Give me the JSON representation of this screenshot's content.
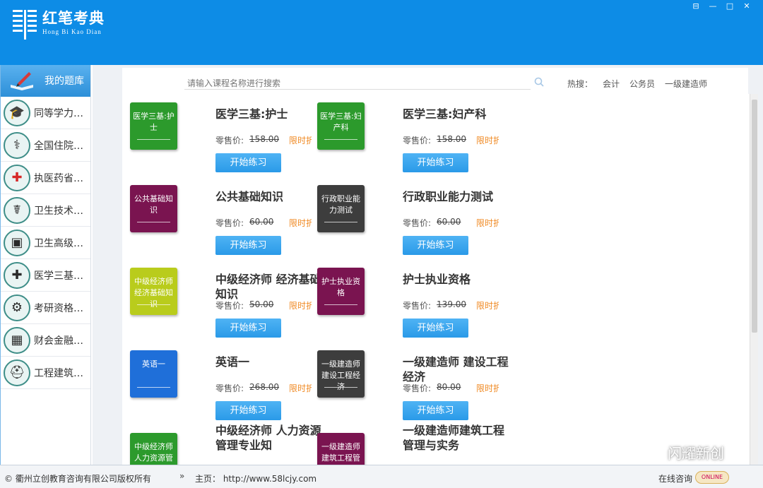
{
  "app": {
    "logo_cn": "红笔考典",
    "logo_en": "Hong Bi Kao Dian"
  },
  "window_buttons": [
    "⊟",
    "—",
    "□",
    "✕"
  ],
  "sidebar": {
    "header": "我的题库",
    "items": [
      {
        "label": "同等学力…",
        "icon": "graduation-cap-icon"
      },
      {
        "label": "全国住院…",
        "icon": "doctor-icon"
      },
      {
        "label": "执医药省…",
        "icon": "red-cross-icon"
      },
      {
        "label": "卫生技术…",
        "icon": "nurse-icon"
      },
      {
        "label": "卫生高级…",
        "icon": "medical-kit-icon"
      },
      {
        "label": "医学三基…",
        "icon": "first-aid-icon"
      },
      {
        "label": "考研资格…",
        "icon": "gear-cluster-icon"
      },
      {
        "label": "财会金融…",
        "icon": "calculator-icon"
      },
      {
        "label": "工程建筑…",
        "icon": "hard-hat-icon"
      }
    ]
  },
  "search": {
    "placeholder": "请输入课程名称进行搜索"
  },
  "hot": {
    "label": "热搜：",
    "terms": [
      "会计",
      "公务员",
      "一级建造师"
    ]
  },
  "price_label": "零售价:",
  "limit_label": "限时折",
  "start_label": "开始练习",
  "courses": [
    {
      "cover": "医学三基:护士",
      "title": "医学三基:护士",
      "price": "158.00",
      "color": "#2c9a2c"
    },
    {
      "cover": "医学三基:妇产科",
      "title": "医学三基:妇产科",
      "price": "158.00",
      "color": "#2c9a2c"
    },
    {
      "cover": "公共基础知识",
      "title": "公共基础知识",
      "price": "60.00",
      "color": "#7a1450"
    },
    {
      "cover": "行政职业能力测试",
      "title": "行政职业能力测试",
      "price": "60.00",
      "color": "#3d3d3d"
    },
    {
      "cover": "中级经济师经济基础知识",
      "title": "中级经济师 经济基础知识",
      "price": "50.00",
      "color": "#b9cc1c"
    },
    {
      "cover": "护士执业资格",
      "title": "护士执业资格",
      "price": "139.00",
      "color": "#7a1450"
    },
    {
      "cover": "英语一",
      "title": "英语一",
      "price": "268.00",
      "color": "#1f6fd9"
    },
    {
      "cover": "一级建造师建设工程经济",
      "title": "一级建造师 建设工程经济",
      "price": "80.00",
      "color": "#3d3d3d"
    },
    {
      "cover": "中级经济师 人力资源管理专业知识与实务",
      "title": "中级经济师 人力资源管理专业知",
      "price": "",
      "color": "#2c9a2c"
    },
    {
      "cover": "一级建造师建筑工程管理与实务",
      "title": "一级建造师建筑工程管理与实务",
      "price": "",
      "color": "#7a1450"
    }
  ],
  "statusbar": {
    "copyright": "© 衢州立创教育咨询有限公司版权所有",
    "arrow": "»",
    "home": "主页： http://www.58lcjy.com",
    "consult": "在线咨询",
    "online": "ONLINE"
  },
  "watermark": "闪耀新创"
}
